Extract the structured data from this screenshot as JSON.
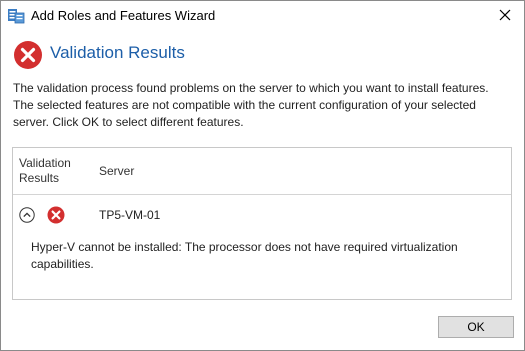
{
  "window": {
    "title": "Add Roles and Features Wizard",
    "close_icon": "close-icon",
    "app_icon": "server-manager-icon"
  },
  "header": {
    "icon": "error-icon",
    "title": "Validation Results",
    "title_color": "#1c5ea8"
  },
  "message": {
    "lines": [
      "The validation process found problems on the server to which you want to install features.",
      "The selected features are not compatible with the current configuration of your selected",
      "server.  Click OK to select different features."
    ]
  },
  "table": {
    "columns": {
      "results_line1": "Validation",
      "results_line2": "Results",
      "server": "Server"
    },
    "rows": [
      {
        "expand_icon": "chevron-up-icon",
        "status_icon": "error-icon",
        "server": "TP5-VM-01",
        "detail_lines": [
          "Hyper-V cannot be installed: The processor does not have required virtualization",
          "capabilities."
        ]
      }
    ]
  },
  "footer": {
    "ok_label": "OK"
  },
  "colors": {
    "error_red": "#d32f2f",
    "accent_blue": "#1c5ea8"
  }
}
